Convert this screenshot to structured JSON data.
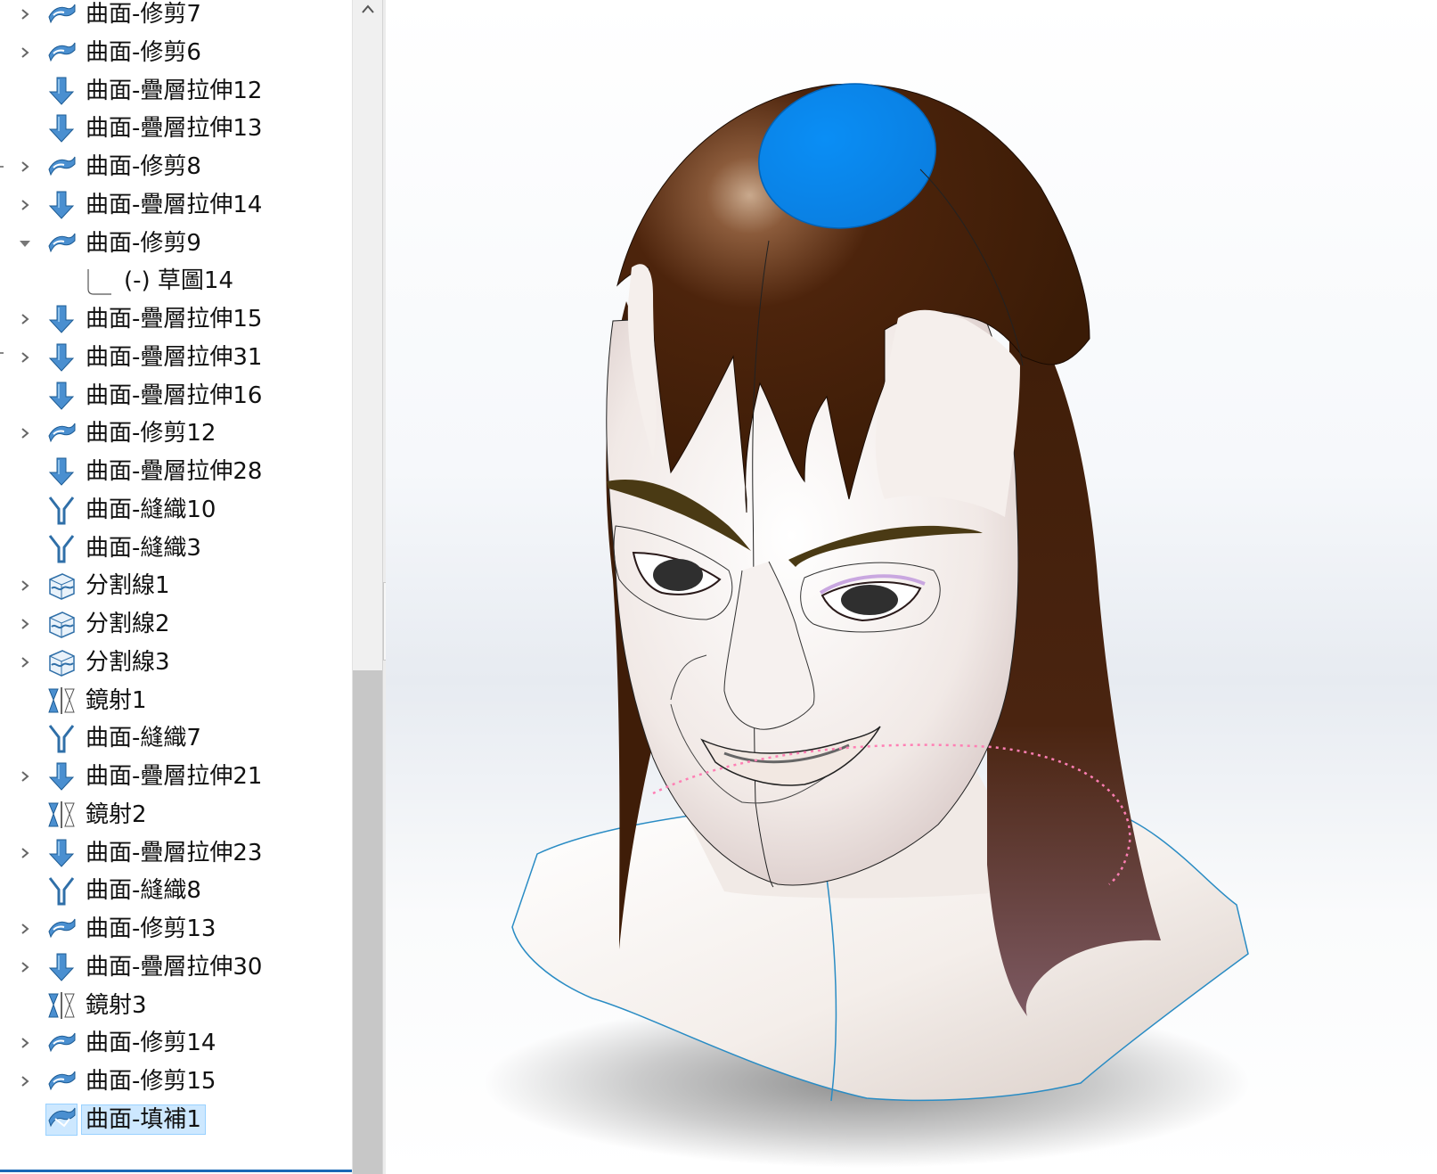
{
  "feature_tree": {
    "items": [
      {
        "label": "曲面-修剪7",
        "icon": "surface-trim-icon",
        "expander": "collapsed",
        "indent": 0
      },
      {
        "label": "曲面-修剪6",
        "icon": "surface-trim-icon",
        "expander": "collapsed",
        "indent": 0
      },
      {
        "label": "曲面-疊層拉伸12",
        "icon": "surface-loft-icon",
        "expander": "none",
        "indent": 0
      },
      {
        "label": "曲面-疊層拉伸13",
        "icon": "surface-loft-icon",
        "expander": "none",
        "indent": 0
      },
      {
        "label": "曲面-修剪8",
        "icon": "surface-trim-icon",
        "expander": "collapsed",
        "indent": 0
      },
      {
        "label": "曲面-疊層拉伸14",
        "icon": "surface-loft-icon",
        "expander": "collapsed",
        "indent": 0
      },
      {
        "label": "曲面-修剪9",
        "icon": "surface-trim-icon",
        "expander": "expanded",
        "indent": 0
      },
      {
        "label": "(-) 草圖14",
        "icon": "sketch-icon",
        "expander": "none",
        "indent": 1
      },
      {
        "label": "曲面-疊層拉伸15",
        "icon": "surface-loft-icon",
        "expander": "collapsed",
        "indent": 0
      },
      {
        "label": "曲面-疊層拉伸31",
        "icon": "surface-loft-icon",
        "expander": "collapsed",
        "indent": 0
      },
      {
        "label": "曲面-疊層拉伸16",
        "icon": "surface-loft-icon",
        "expander": "none",
        "indent": 0
      },
      {
        "label": "曲面-修剪12",
        "icon": "surface-trim-icon",
        "expander": "collapsed",
        "indent": 0
      },
      {
        "label": "曲面-疊層拉伸28",
        "icon": "surface-loft-icon",
        "expander": "none",
        "indent": 0
      },
      {
        "label": "曲面-縫織10",
        "icon": "surface-knit-icon",
        "expander": "none",
        "indent": 0
      },
      {
        "label": "曲面-縫織3",
        "icon": "surface-knit-icon",
        "expander": "none",
        "indent": 0
      },
      {
        "label": "分割線1",
        "icon": "split-line-icon",
        "expander": "collapsed",
        "indent": 0
      },
      {
        "label": "分割線2",
        "icon": "split-line-icon",
        "expander": "collapsed",
        "indent": 0
      },
      {
        "label": "分割線3",
        "icon": "split-line-icon",
        "expander": "collapsed",
        "indent": 0
      },
      {
        "label": "鏡射1",
        "icon": "mirror-icon",
        "expander": "none",
        "indent": 0
      },
      {
        "label": "曲面-縫織7",
        "icon": "surface-knit-icon",
        "expander": "none",
        "indent": 0
      },
      {
        "label": "曲面-疊層拉伸21",
        "icon": "surface-loft-icon",
        "expander": "collapsed",
        "indent": 0
      },
      {
        "label": "鏡射2",
        "icon": "mirror-icon",
        "expander": "none",
        "indent": 0
      },
      {
        "label": "曲面-疊層拉伸23",
        "icon": "surface-loft-icon",
        "expander": "collapsed",
        "indent": 0
      },
      {
        "label": "曲面-縫織8",
        "icon": "surface-knit-icon",
        "expander": "none",
        "indent": 0
      },
      {
        "label": "曲面-修剪13",
        "icon": "surface-trim-icon",
        "expander": "collapsed",
        "indent": 0
      },
      {
        "label": "曲面-疊層拉伸30",
        "icon": "surface-loft-icon",
        "expander": "collapsed",
        "indent": 0
      },
      {
        "label": "鏡射3",
        "icon": "mirror-icon",
        "expander": "none",
        "indent": 0
      },
      {
        "label": "曲面-修剪14",
        "icon": "surface-trim-icon",
        "expander": "collapsed",
        "indent": 0
      },
      {
        "label": "曲面-修剪15",
        "icon": "surface-trim-icon",
        "expander": "collapsed",
        "indent": 0
      },
      {
        "label": "曲面-填補1",
        "icon": "surface-fill-icon",
        "expander": "none",
        "indent": 0,
        "selected": true
      }
    ]
  },
  "colors": {
    "accent_blue": "#4a8fd0",
    "icon_dark_blue": "#2f6fa8",
    "selection_bg": "#cde8ff",
    "hair_brown": "#3e1f0a",
    "skin": "#f2ece8",
    "fill_surface_blue": "#0a86f0",
    "eyebrow": "#4a3a14",
    "preview_dotted": "#ff7fb4"
  },
  "viewport": {
    "model": "head-bust-surface-model",
    "highlighted_feature": "曲面-填補1"
  }
}
